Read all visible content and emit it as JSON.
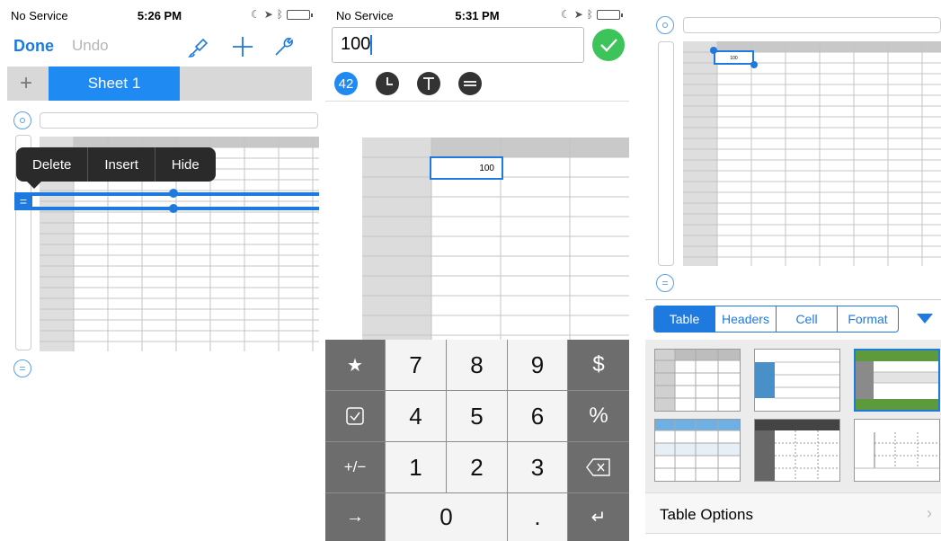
{
  "panel1": {
    "status": {
      "carrier": "No Service",
      "time": "5:26 PM"
    },
    "nav": {
      "done": "Done",
      "undo": "Undo"
    },
    "tabs": {
      "add": "+",
      "sheet": "Sheet 1"
    },
    "context_menu": {
      "delete": "Delete",
      "insert": "Insert",
      "hide": "Hide"
    },
    "row_handle": "="
  },
  "panel2": {
    "status": {
      "carrier": "No Service",
      "time": "5:31 PM"
    },
    "input": {
      "value": "100"
    },
    "format_buttons": {
      "number": "42"
    },
    "cell_value": "100",
    "keys": {
      "star": "★",
      "k7": "7",
      "k8": "8",
      "k9": "9",
      "dollar": "$",
      "k4": "4",
      "k5": "5",
      "k6": "6",
      "percent": "%",
      "plusminus": "+/−",
      "k1": "1",
      "k2": "2",
      "k3": "3",
      "arrow": "→",
      "k0": "0",
      "dot": ".",
      "enter": "↵"
    }
  },
  "panel3": {
    "cell_value": "100",
    "tabs": [
      "Table",
      "Headers",
      "Cell",
      "Format"
    ],
    "table_options": "Table Options",
    "colors": {
      "accent": "#1f7ae0",
      "green": "#5d9a3c",
      "blue_style": "#4a90c8",
      "dark_style": "#444444"
    }
  }
}
